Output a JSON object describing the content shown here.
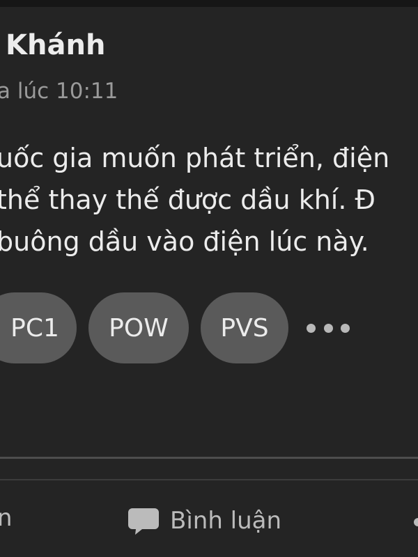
{
  "post": {
    "author": "Khánh",
    "time": "a lúc 10:11",
    "body_lines": [
      "uốc gia muốn phát triển, điện",
      " thể thay thế được dầu khí. Đ",
      "buông dầu vào điện lúc này."
    ],
    "tags": [
      "PC1",
      "POW",
      "PVS"
    ]
  },
  "actions": {
    "like_label_fragment": "n",
    "comment_label": "Bình luận"
  },
  "icons": {
    "more": "more-dots-icon",
    "comment": "comment-bubble-icon",
    "share": "share-icon"
  },
  "colors": {
    "background": "#242424",
    "chip": "#5a5a5a",
    "muted_text": "#9a9a9a"
  }
}
